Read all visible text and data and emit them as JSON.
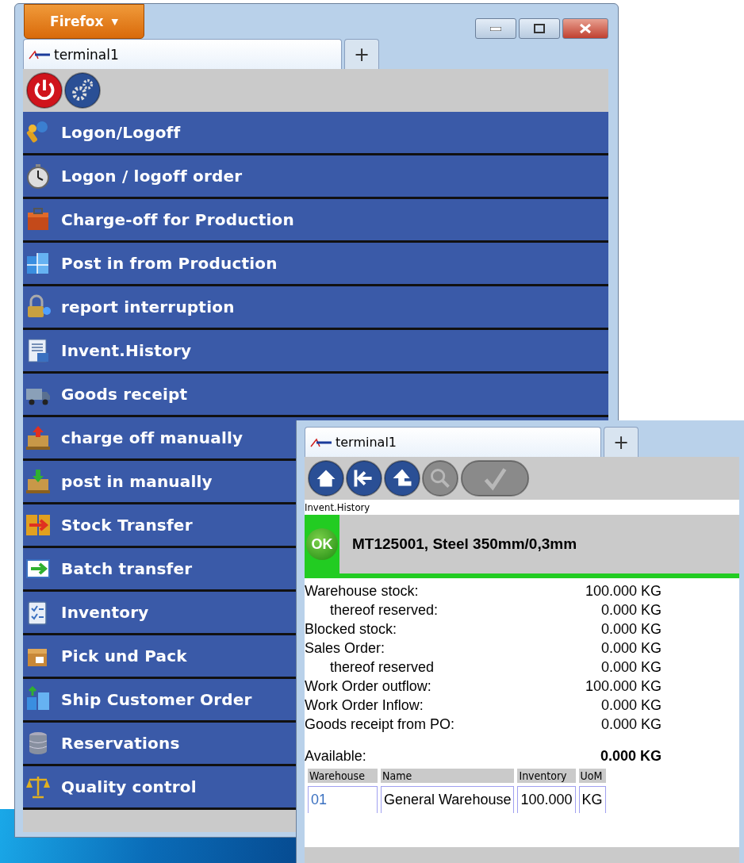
{
  "main_window": {
    "app_button": "Firefox",
    "app_caret": "▼",
    "tabs": [
      {
        "label": "terminal1",
        "selected": true
      }
    ],
    "new_tab": "+",
    "toolbar": [
      {
        "kind": "power"
      },
      {
        "kind": "settings"
      }
    ],
    "menu": [
      {
        "label": "Logon/Logoff"
      },
      {
        "label": "Logon / logoff order"
      },
      {
        "label": "Charge-off for Production"
      },
      {
        "label": "Post in from Production"
      },
      {
        "label": "report interruption"
      },
      {
        "label": "Invent.History"
      },
      {
        "label": "Goods receipt"
      },
      {
        "label": "charge off manually"
      },
      {
        "label": "post in manually"
      },
      {
        "label": "Stock Transfer"
      },
      {
        "label": "Batch transfer"
      },
      {
        "label": "Inventory"
      },
      {
        "label": "Pick und Pack"
      },
      {
        "label": "Ship Customer Order"
      },
      {
        "label": "Reservations"
      },
      {
        "label": "Quality control"
      }
    ]
  },
  "detail_window": {
    "tabs": [
      {
        "label": "terminal1",
        "selected": true
      }
    ],
    "new_tab": "+",
    "toolbar": [
      {
        "kind": "home",
        "disabled": false
      },
      {
        "kind": "back",
        "disabled": false
      },
      {
        "kind": "up",
        "disabled": false
      },
      {
        "kind": "search",
        "disabled": true
      },
      {
        "kind": "confirm",
        "disabled": true
      }
    ],
    "page_title": "Invent.History",
    "header": {
      "badge": "OK",
      "title": "MT125001, Steel 350mm/0,3mm"
    },
    "stock": [
      {
        "label": "Warehouse stock:",
        "value": "100.000 KG",
        "children": [
          {
            "label": "thereof reserved:",
            "value": "0.000 KG"
          }
        ]
      },
      {
        "label": "Blocked stock:",
        "value": "0.000 KG"
      },
      {
        "label": "Sales Order:",
        "value": "0.000 KG",
        "children": [
          {
            "label": "thereof reserved",
            "value": "0.000 KG"
          }
        ]
      },
      {
        "label": "Work Order outflow:",
        "value": "100.000 KG"
      },
      {
        "label": "Work Order Inflow:",
        "value": "0.000 KG"
      },
      {
        "label": "Goods receipt from PO:",
        "value": "0.000 KG"
      }
    ],
    "available": {
      "label": "Available:",
      "value": "0.000 KG"
    },
    "table": {
      "columns": [
        "Warehouse",
        "Name",
        "Inventory",
        "UoM"
      ],
      "rows": [
        [
          "01",
          "General Warehouse",
          "100.000",
          "KG"
        ]
      ]
    }
  }
}
